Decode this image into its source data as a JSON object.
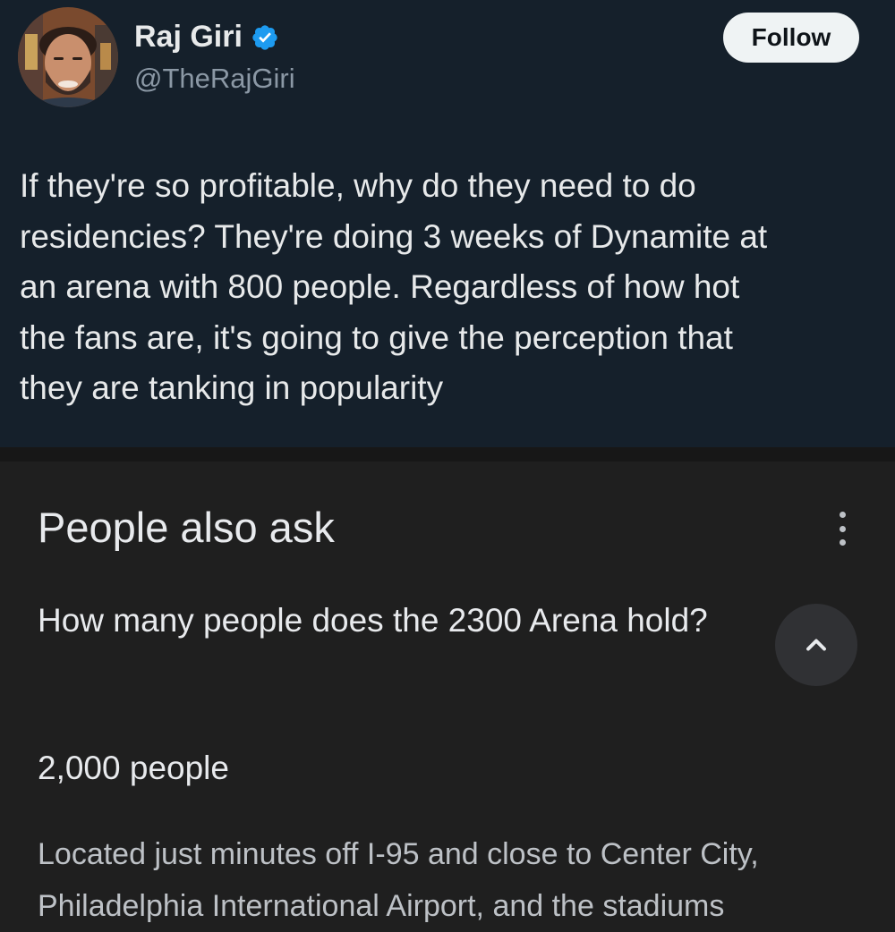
{
  "tweet": {
    "author_name": "Raj Giri",
    "handle": "@TheRajGiri",
    "follow_label": "Follow",
    "text_lines": [
      "If they're so profitable, why do they need to do",
      "residencies? They're doing 3 weeks of Dynamite at",
      "an arena with 800 people. Regardless of how hot",
      "the fans are, it's going to give the perception that",
      "they are tanking in popularity"
    ],
    "icons": {
      "verified": "verified-badge-icon",
      "avatar": "profile-photo"
    },
    "colors": {
      "background": "#15202b",
      "verified": "#1d9bf0",
      "follow_bg": "#eff3f4"
    }
  },
  "people_also_ask": {
    "title": "People also ask",
    "question": "How many people does the 2300 Arena hold?",
    "answer": "2,000 people",
    "snippet_lines": [
      "Located just minutes off I-95 and close to Center City,",
      "Philadelphia International Airport, and the stadiums"
    ],
    "icons": {
      "menu": "more-vert-icon",
      "collapse": "chevron-up-icon"
    },
    "colors": {
      "background": "#1f1f1f",
      "button_bg": "#303134"
    }
  }
}
